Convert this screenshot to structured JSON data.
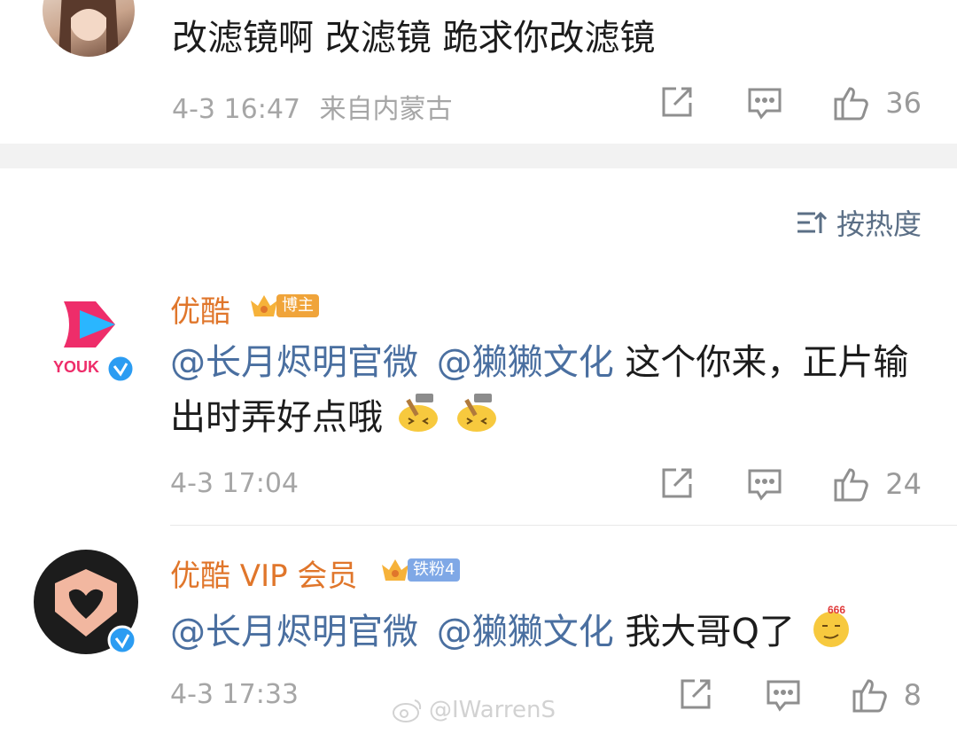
{
  "top_comment": {
    "text": "改滤镜啊  改滤镜  跪求你改滤镜",
    "time": "4-3 16:47",
    "location": "来自内蒙古",
    "likes": "36"
  },
  "sort": {
    "label": "按热度",
    "icon": "sort-lines-icon"
  },
  "comments": [
    {
      "username": "优酷",
      "badge": "博主",
      "badge_color": "#f0a43a",
      "mention1": "@长月烬明官微",
      "mention2": "@獭獭文化",
      "text": " 这个你来，正片输出时弄好点哦",
      "emoji": "hammer-emoji",
      "time": "4-3 17:04",
      "likes": "24",
      "avatar_logo": "YOUK"
    },
    {
      "username": "优酷 VIP 会员",
      "badge": "铁粉4",
      "badge_color": "#7fa8e6",
      "mention1": "@长月烬明官微",
      "mention2": "@獭獭文化",
      "text": " 我大哥Q了",
      "emoji": "666-emoji",
      "time": "4-3 17:33",
      "likes": "8"
    }
  ],
  "watermark": "@IWarrenS",
  "colors": {
    "mention": "#4a6fa0",
    "username": "#e0762b",
    "meta": "#a6a6a6"
  }
}
